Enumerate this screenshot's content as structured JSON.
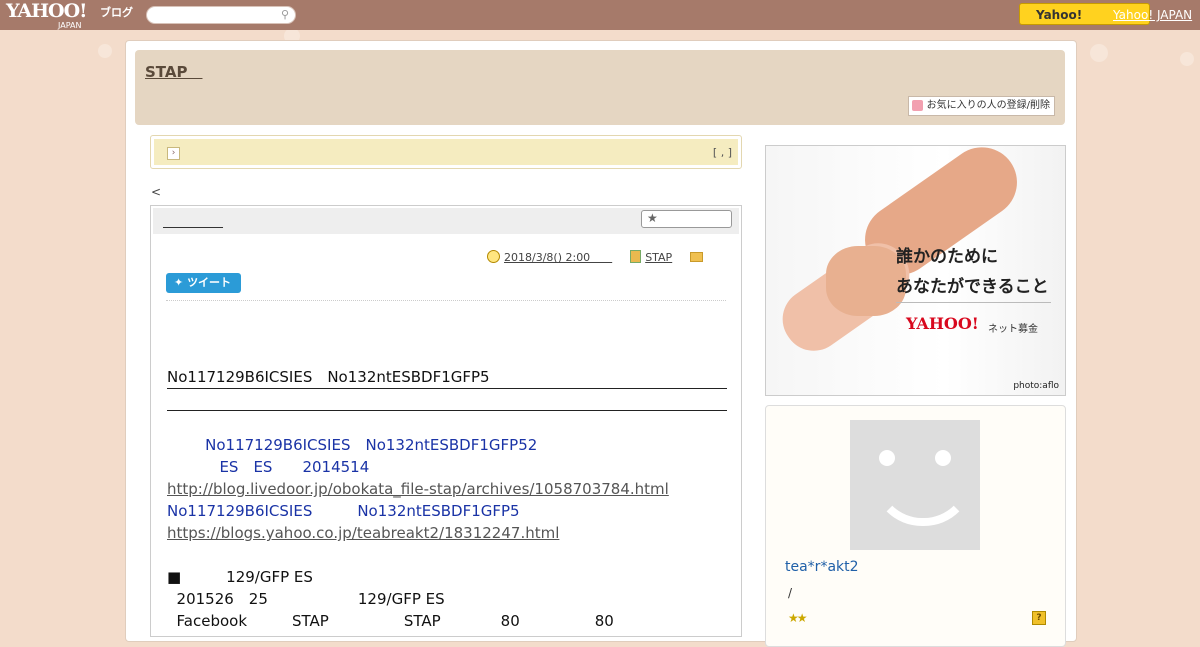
{
  "topbar": {
    "logo": "YAHOO!",
    "logo_sub": "JAPAN",
    "logo_blog": "ブログ",
    "search_placeholder": "",
    "yahoo_button": "Yahoo!",
    "yahoo_japan_link": "Yahoo! JAPAN"
  },
  "blog_header": {
    "title": "STAP　",
    "favorite_button": "お気に入りの人の登録/削除"
  },
  "notice": {
    "meta": "[ , ]"
  },
  "nav": {
    "back": "<"
  },
  "article": {
    "title": "　　　　　",
    "date": "2018/3/8()  2:00　　",
    "category": "STAP",
    "tweet_label": "ツイート",
    "lines": {
      "heading": "No117129B6ICSIES　No132ntESBDF1GFP5　　　　　　　",
      "blue1": "        No117129B6ICSIES　No132ntESBDF1GFP52",
      "blue2": "           ES　ES　　2014514",
      "link1": "http://blog.livedoor.jp/obokata_file-stap/archives/1058703784.html",
      "blue3": "No117129B6ICSIES　　　No132ntESBDF1GFP5",
      "link2": "https://blogs.yahoo.co.jp/teabreakt2/18312247.html",
      "p1": "■　　　129/GFP ES",
      "p2": "  201526　25　　　　　　129/GFP ES",
      "p3": "  Facebook　　　STAP　　　　　STAP　　　　80　　　　　80"
    }
  },
  "sidebar": {
    "ad": {
      "line1": "誰かのために",
      "line2": "あなたができること",
      "brand": "YAHOO!",
      "brand_sub": "ネット募金",
      "credit": "photo:aflo"
    },
    "profile": {
      "name": "tea*r*akt2",
      "slash": "/",
      "stars": "★★",
      "question": "?"
    }
  },
  "colors": {
    "topbar": "#a67a6a",
    "background": "#f3dccb",
    "header": "#e5d6c2",
    "notice": "#f5ecc0",
    "tweet": "#2b9bd7",
    "blue_text": "#1a33a6",
    "yahoo_button": "#ffd21f"
  }
}
